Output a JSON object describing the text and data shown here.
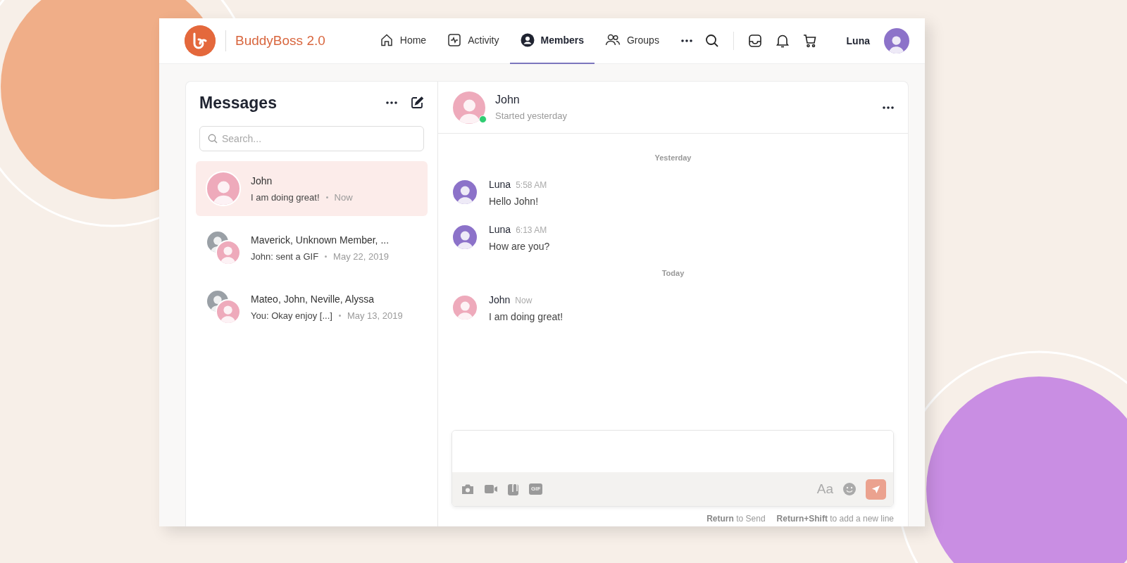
{
  "brand": {
    "name": "BuddyBoss 2.0"
  },
  "nav": [
    {
      "kind": "home",
      "label": "Home",
      "selected": false
    },
    {
      "kind": "activity",
      "label": "Activity",
      "selected": false
    },
    {
      "kind": "members",
      "label": "Members",
      "selected": true
    },
    {
      "kind": "groups",
      "label": "Groups",
      "selected": false
    }
  ],
  "user": {
    "name": "Luna"
  },
  "messages_panel": {
    "title": "Messages",
    "search": {
      "placeholder": "Search..."
    },
    "threads": [
      {
        "kind": "single",
        "name": "John",
        "preview": "I am doing great!",
        "time": "Now",
        "selected": true
      },
      {
        "kind": "group",
        "name": "Maverick, Unknown Member, ...",
        "preview": "John: sent a GIF",
        "time": "May 22, 2019",
        "selected": false
      },
      {
        "kind": "group",
        "name": "Mateo, John, Neville, Alyssa",
        "preview": "You: Okay enjoy [...]",
        "time": "May 13, 2019",
        "selected": false
      }
    ]
  },
  "chat": {
    "name": "John",
    "subtitle": "Started yesterday",
    "online": true,
    "feed": [
      {
        "kind": "divider",
        "label": "Yesterday"
      },
      {
        "kind": "message",
        "sender": "Luna",
        "time": "5:58 AM",
        "text": "Hello John!"
      },
      {
        "kind": "message",
        "sender": "Luna",
        "time": "6:13 AM",
        "text": "How are you?"
      },
      {
        "kind": "divider",
        "label": "Today"
      },
      {
        "kind": "message",
        "sender": "John",
        "time": "Now",
        "text": "I am doing great!"
      }
    ]
  },
  "composer": {
    "tools": [
      {
        "kind": "camera"
      },
      {
        "kind": "video"
      },
      {
        "kind": "attachment"
      },
      {
        "kind": "gif",
        "label": "GIF"
      }
    ],
    "format_label": "Aa",
    "hints": [
      "**Return** to Send",
      "**Return+Shift** to add a new line"
    ]
  }
}
